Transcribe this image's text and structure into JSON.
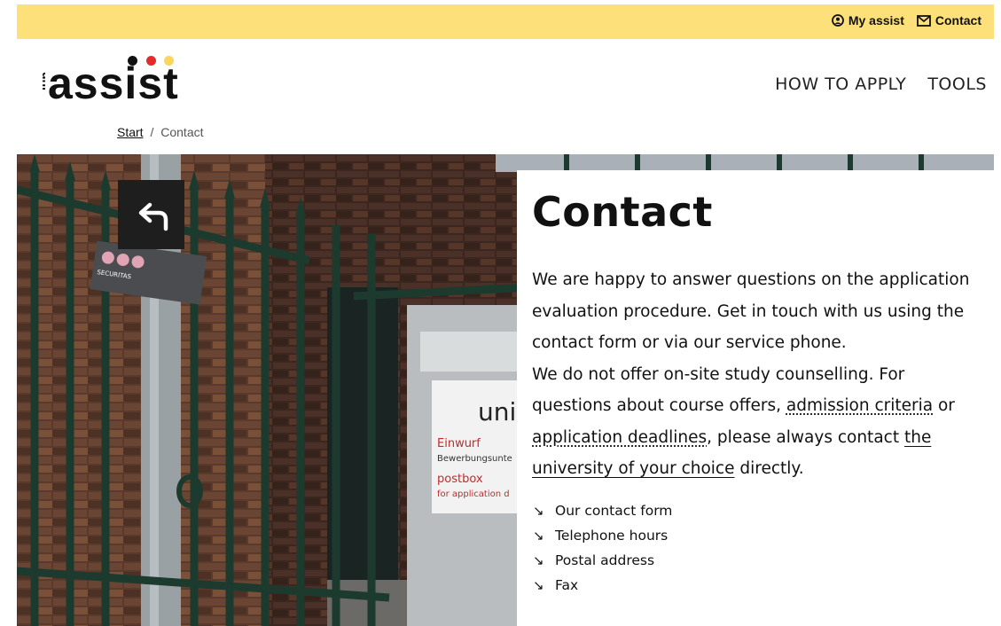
{
  "topbar": {
    "my_assist": "My assist",
    "contact": "Contact",
    "bg_color": "#fde07a"
  },
  "logo": {
    "prefix": "uni",
    "word": "assist",
    "dot_colors": [
      "#111111",
      "#e32b2b",
      "#fbd65a"
    ]
  },
  "nav": {
    "items": [
      "HOW TO APPLY",
      "TOOLS"
    ]
  },
  "breadcrumb": {
    "start": "Start",
    "separator": "/",
    "current": "Contact"
  },
  "hero": {
    "back_icon": "back-arrow-icon",
    "sign_brand": "SECURITAS",
    "postbox_logo": "uni as",
    "postbox_lines": [
      "Einwurf",
      "Bewerbungsunte",
      "postbox",
      "for application d"
    ]
  },
  "panel": {
    "title": "Contact",
    "para1": "We are happy to answer questions on the application evaluation procedure. Get in touch with us using the contact form or via our service phone.",
    "para2_a": "We do not offer on-site study counselling. For questions about course offers, ",
    "link_admission": "admission criteria",
    "para2_b": " or ",
    "link_deadlines": "application deadlines",
    "para2_c": ", please always contact ",
    "link_university": "the university of your choice",
    "para2_d": " directly.",
    "anchor_arrow": "↘",
    "anchors": [
      "Our contact form",
      "Telephone hours",
      "Postal address",
      "Fax"
    ]
  }
}
